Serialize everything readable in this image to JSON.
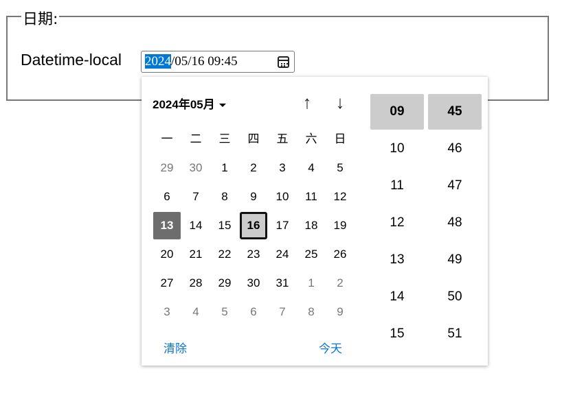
{
  "fieldset": {
    "legend": "日期:"
  },
  "field": {
    "label": "Datetime-local",
    "value_year": "2024",
    "value_rest": "/05/16 09:45",
    "icon": "calendar-icon"
  },
  "picker": {
    "month_label": "2024年05月",
    "prev_label": "↑",
    "next_label": "↓",
    "weekdays": [
      "一",
      "二",
      "三",
      "四",
      "五",
      "六",
      "日"
    ],
    "weeks": [
      [
        "29",
        "30",
        "1",
        "2",
        "3",
        "4",
        "5"
      ],
      [
        "6",
        "7",
        "8",
        "9",
        "10",
        "11",
        "12"
      ],
      [
        "13",
        "14",
        "15",
        "16",
        "17",
        "18",
        "19"
      ],
      [
        "20",
        "21",
        "22",
        "23",
        "24",
        "25",
        "26"
      ],
      [
        "27",
        "28",
        "29",
        "30",
        "31",
        "1",
        "2"
      ],
      [
        "3",
        "4",
        "5",
        "6",
        "7",
        "8",
        "9"
      ]
    ],
    "today": "13",
    "selected": "16",
    "hours": [
      "09",
      "10",
      "11",
      "12",
      "13",
      "14",
      "15"
    ],
    "minutes": [
      "45",
      "46",
      "47",
      "48",
      "49",
      "50",
      "51"
    ],
    "selected_hour": "09",
    "selected_minute": "45",
    "clear_label": "清除",
    "today_label": "今天",
    "link_color": "#0a75d6"
  }
}
